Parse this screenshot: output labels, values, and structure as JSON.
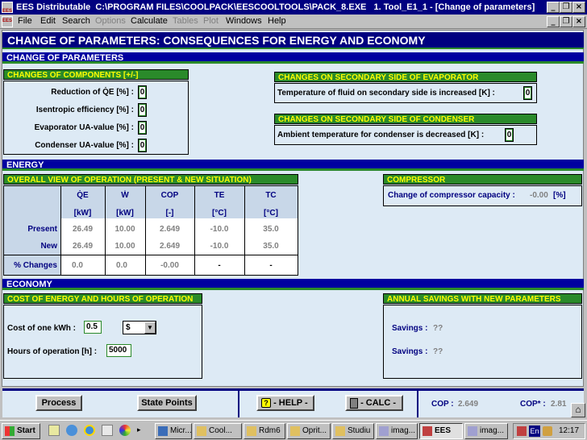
{
  "window": {
    "app": "EES Distributable",
    "path": "C:\\PROGRAM FILES\\COOLPACK\\EESCOOLTOOLS\\PACK_8.EXE",
    "doc": "1. Tool_E1_1 - [Change of parameters]"
  },
  "menu": [
    "File",
    "Edit",
    "Search",
    "Options",
    "Calculate",
    "Tables",
    "Plot",
    "Windows",
    "Help"
  ],
  "menu_disabled": [
    false,
    false,
    false,
    true,
    false,
    true,
    true,
    false,
    false
  ],
  "title": "CHANGE OF PARAMETERS: CONSEQUENCES FOR ENERGY AND ECONOMY",
  "sections": {
    "change": "CHANGE OF PARAMETERS",
    "energy": "ENERGY",
    "economy": "ECONOMY"
  },
  "components": {
    "header": "CHANGES OF COMPONENTS [+/-]",
    "rows": [
      {
        "label": "Reduction of Q̇E [%] :",
        "value": "0"
      },
      {
        "label": "Isentropic efficiency [%] :",
        "value": "0"
      },
      {
        "label": "Evaporator UA-value [%] :",
        "value": "0"
      },
      {
        "label": "Condenser UA-value [%] :",
        "value": "0"
      }
    ]
  },
  "evaporator": {
    "header": "CHANGES ON SECONDARY SIDE OF EVAPORATOR",
    "label": "Temperature of fluid on secondary side is increased [K] :",
    "value": "0"
  },
  "condenser": {
    "header": "CHANGES ON SECONDARY SIDE OF CONDENSER",
    "label": "Ambient temperature for condenser is decreased [K] :",
    "value": "0"
  },
  "overview": {
    "header": "OVERALL VIEW OF OPERATION (PRESENT & NEW SITUATION)",
    "columns": [
      "Q̇E",
      "Ẇ",
      "COP",
      "TE",
      "TC"
    ],
    "units": [
      "[kW]",
      "[kW]",
      "[-]",
      "[°C]",
      "[°C]"
    ],
    "rows": [
      {
        "label": "Present",
        "values": [
          "26.49",
          "10.00",
          "2.649",
          "-10.0",
          "35.0"
        ]
      },
      {
        "label": "New",
        "values": [
          "26.49",
          "10.00",
          "2.649",
          "-10.0",
          "35.0"
        ]
      },
      {
        "label": "% Changes",
        "values": [
          "0.0",
          "0.0",
          "-0.00",
          "-",
          "-"
        ]
      }
    ]
  },
  "compressor": {
    "header": "COMPRESSOR",
    "label": "Change of compressor capacity :",
    "value": "-0.00",
    "unit": "[%]"
  },
  "cost": {
    "header": "COST OF ENERGY AND HOURS OF OPERATION",
    "kwh_label": "Cost of one kWh :",
    "kwh_value": "0.5",
    "currency": "$",
    "hours_label": "Hours of operation [h] :",
    "hours_value": "5000"
  },
  "savings": {
    "header": "ANNUAL SAVINGS WITH NEW PARAMETERS",
    "rows": [
      {
        "label": "Savings :",
        "value": "??"
      },
      {
        "label": "Savings :",
        "value": "??"
      }
    ]
  },
  "bottom": {
    "process": "Process",
    "state_points": "State Points",
    "help": "- HELP -",
    "calc": "- CALC -",
    "cop_label": "COP :",
    "cop_value": "2.649",
    "cop_new_label": "COP* :",
    "cop_new_value": "2.81"
  },
  "taskbar": {
    "start": "Start",
    "items": [
      "Micr...",
      "Cool...",
      "Rdm6",
      "Oprit...",
      "Studiu",
      "imag...",
      "EES",
      "imag..."
    ],
    "lang": "En",
    "clock": "12:17"
  }
}
